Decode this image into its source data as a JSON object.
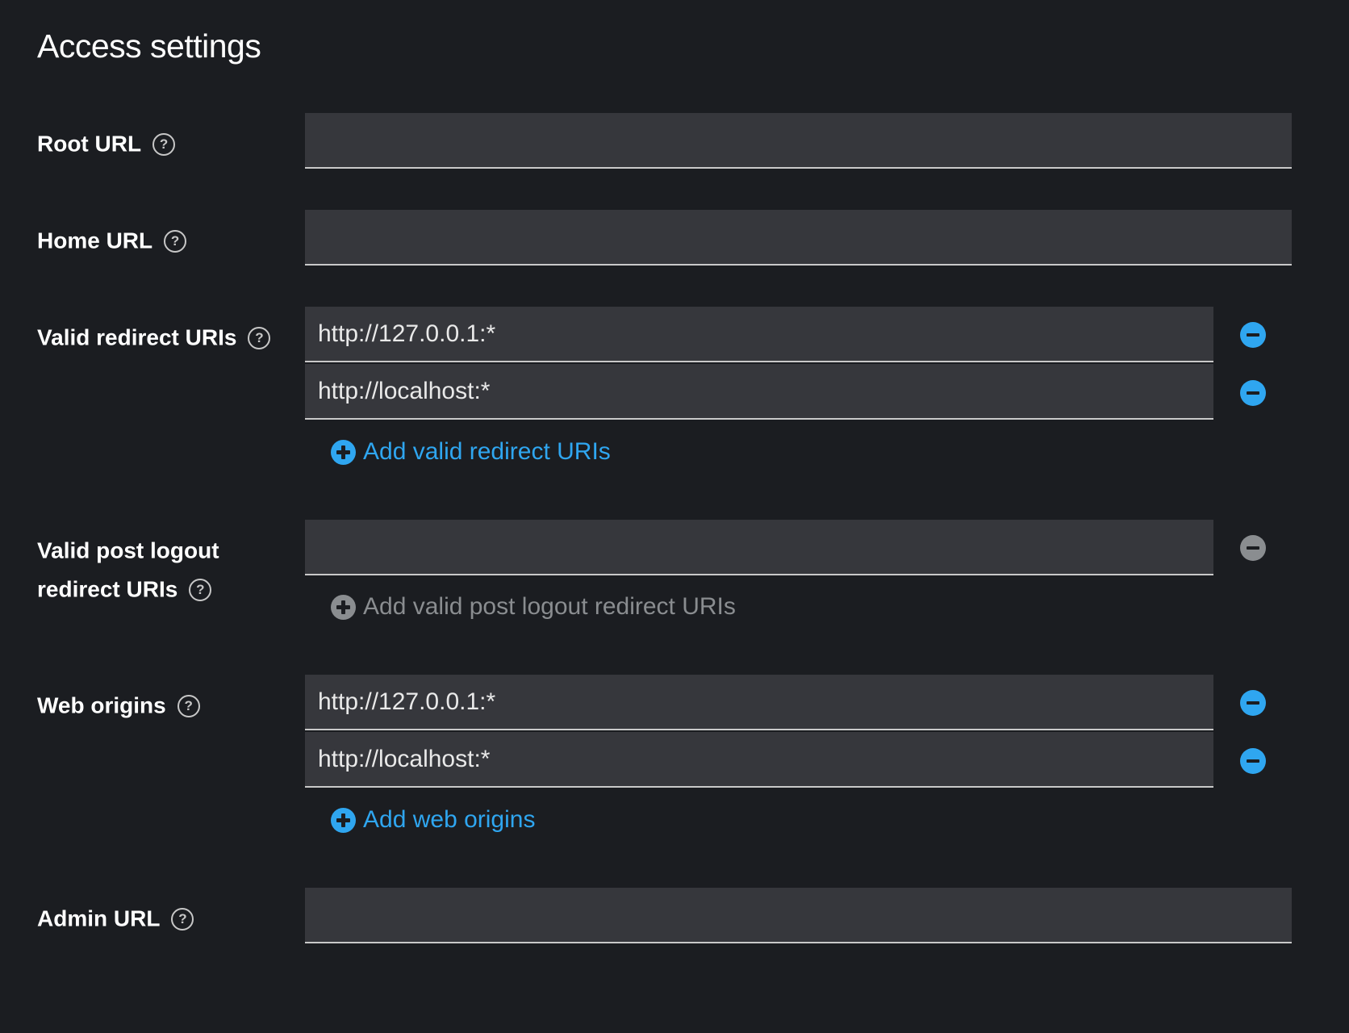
{
  "section": {
    "title": "Access settings"
  },
  "fields": {
    "root_url": {
      "label": "Root URL",
      "value": ""
    },
    "home_url": {
      "label": "Home URL",
      "value": ""
    },
    "valid_redirect_uris": {
      "label": "Valid redirect URIs",
      "values": [
        "http://127.0.0.1:*",
        "http://localhost:*"
      ],
      "add_label": "Add valid redirect URIs"
    },
    "valid_post_logout_redirect_uris": {
      "label_line1": "Valid post logout",
      "label_line2": "redirect URIs",
      "values": [
        ""
      ],
      "add_label": "Add valid post logout redirect URIs"
    },
    "web_origins": {
      "label": "Web origins",
      "values": [
        "http://127.0.0.1:*",
        "http://localhost:*"
      ],
      "add_label": "Add web origins"
    },
    "admin_url": {
      "label": "Admin URL",
      "value": ""
    }
  },
  "icons": {
    "help": "question-circle-icon",
    "remove": "minus-circle-icon",
    "add": "plus-circle-icon"
  },
  "colors": {
    "background": "#1b1d21",
    "input_bg": "#36373c",
    "link_blue": "#2fa6f0",
    "disabled_gray": "#8a8d90"
  }
}
